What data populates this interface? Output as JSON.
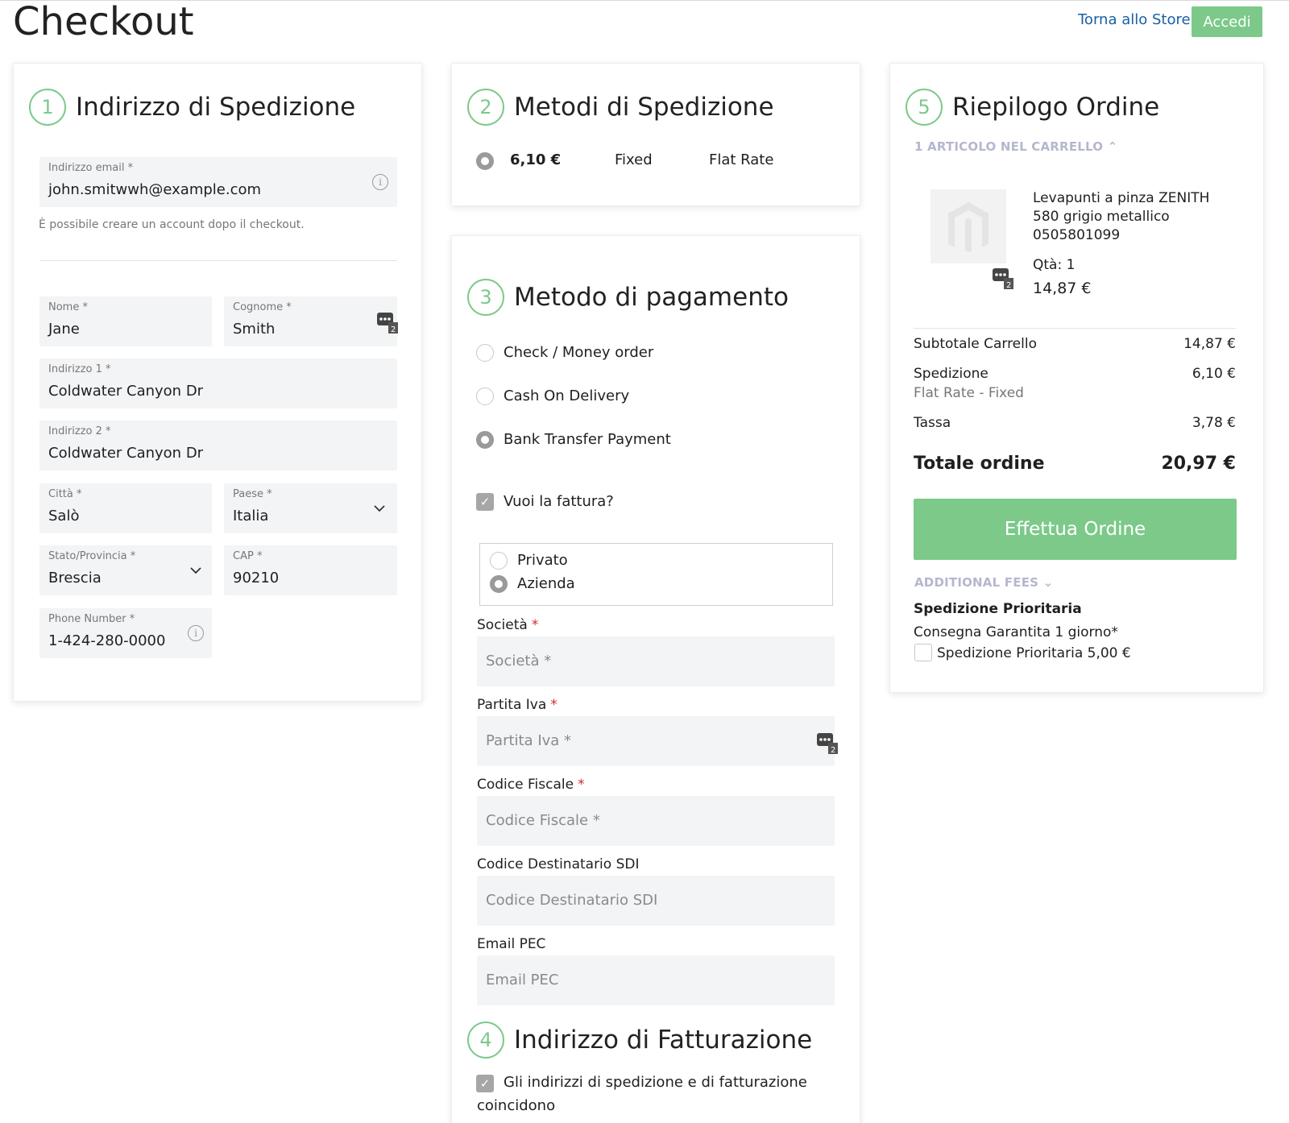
{
  "header": {
    "title": "Checkout",
    "store_link": "Torna allo Store",
    "login_label": "Accedi",
    "accent_color": "#7cc98a"
  },
  "shipping_address": {
    "step": "1",
    "title": "Indirizzo di Spedizione",
    "email": {
      "label": "Indirizzo email *",
      "value": "john.smitwwh@example.com"
    },
    "email_note": "È possibile creare un account dopo il checkout.",
    "first_name": {
      "label": "Nome *",
      "value": "Jane"
    },
    "last_name": {
      "label": "Cognome *",
      "value": "Smith"
    },
    "address1": {
      "label": "Indirizzo 1 *",
      "value": "Coldwater Canyon Dr"
    },
    "address2": {
      "label": "Indirizzo 2 *",
      "value": "Coldwater Canyon Dr"
    },
    "city": {
      "label": "Città *",
      "value": "Salò"
    },
    "country": {
      "label": "Paese *",
      "value": "Italia"
    },
    "region": {
      "label": "Stato/Provincia *",
      "value": "Brescia"
    },
    "zip": {
      "label": "CAP *",
      "value": "90210"
    },
    "phone": {
      "label": "Phone Number *",
      "value": "1-424-280-0000"
    }
  },
  "shipping_methods": {
    "step": "2",
    "title": "Metodi di Spedizione",
    "options": [
      {
        "price": "6,10 €",
        "method": "Fixed",
        "carrier": "Flat Rate",
        "selected": true
      }
    ]
  },
  "payment": {
    "step": "3",
    "title": "Metodo di pagamento",
    "methods": [
      {
        "label": "Check / Money order",
        "selected": false
      },
      {
        "label": "Cash On Delivery",
        "selected": false
      },
      {
        "label": "Bank Transfer Payment",
        "selected": true
      }
    ],
    "invoice_label": "Vuoi la fattura?",
    "invoice_checked": true,
    "customer_types": [
      {
        "label": "Privato",
        "selected": false
      },
      {
        "label": "Azienda",
        "selected": true
      }
    ],
    "fields": [
      {
        "label": "Società",
        "required": "*",
        "placeholder": "Società *"
      },
      {
        "label": "Partita Iva",
        "required": "*",
        "placeholder": "Partita Iva *"
      },
      {
        "label": "Codice Fiscale",
        "required": "*",
        "placeholder": "Codice Fiscale *"
      },
      {
        "label": "Codice Destinatario SDI",
        "required": "",
        "placeholder": "Codice Destinatario SDI"
      },
      {
        "label": "Email PEC",
        "required": "",
        "placeholder": "Email PEC"
      }
    ]
  },
  "billing": {
    "step": "4",
    "title": "Indirizzo di Fatturazione",
    "same_as_shipping_line1": "Gli indirizzi di spedizione e di fatturazione",
    "same_as_shipping_line2": "coincidono",
    "same_checked": true
  },
  "summary": {
    "step": "5",
    "title": "Riepilogo Ordine",
    "cart_count": "1 ARTICOLO NEL CARRELLO",
    "item": {
      "name_line1": "Levapunti a pinza ZENITH",
      "name_line2": "580 grigio metallico",
      "name_line3": "0505801099",
      "qty": "Qtà: 1",
      "price": "14,87 €"
    },
    "subtotal_label": "Subtotale Carrello",
    "subtotal_value": "14,87 €",
    "shipping_label": "Spedizione",
    "shipping_sub": "Flat Rate - Fixed",
    "shipping_value": "6,10 €",
    "tax_label": "Tassa",
    "tax_value": "3,78 €",
    "total_label": "Totale ordine",
    "total_value": "20,97 €",
    "place_order": "Effettua Ordine",
    "additional_fees": "ADDITIONAL FEES",
    "priority_title": "Spedizione Prioritaria",
    "priority_desc": "Consegna Garantita 1 giorno*",
    "priority_option": "Spedizione Prioritaria 5,00 €",
    "priority_checked": false
  }
}
